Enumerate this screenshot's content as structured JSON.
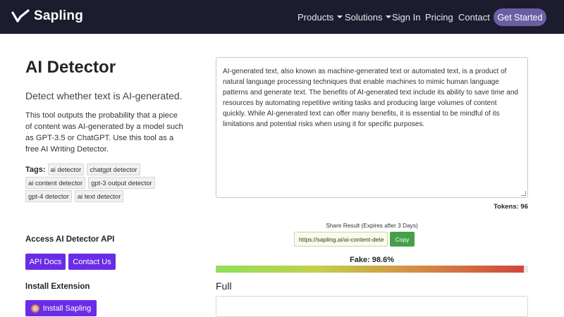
{
  "navbar": {
    "brand": "Sapling",
    "items": [
      {
        "label": "Products",
        "dropdown": true
      },
      {
        "label": "Solutions",
        "dropdown": true
      },
      {
        "label": "Sign In",
        "dropdown": false
      },
      {
        "label": "Pricing",
        "dropdown": false
      },
      {
        "label": "Contact",
        "dropdown": false
      }
    ],
    "cta": "Get Started"
  },
  "left": {
    "title": "AI Detector",
    "lead": "Detect whether text is AI-generated.",
    "description": "This tool outputs the probability that a piece of content was AI-generated by a model such as GPT-3.5 or ChatGPT. Use this tool as a free AI Writing Detector.",
    "tags_label": "Tags",
    "tags": [
      "ai detector",
      "chatgpt detector",
      "ai content detector",
      "gpt-3 output detector",
      "gpt-4 detector",
      "ai text detector"
    ],
    "api_heading": "Access AI Detector API",
    "api_docs_label": "API Docs",
    "contact_us_label": "Contact Us",
    "extension_heading": "Install Extension",
    "install_label": "Install Sapling"
  },
  "right": {
    "input_text": "AI-generated text, also known as machine-generated text or automated text, is a product of natural language processing techniques that enable machines to mimic human language patterns and generate text. The benefits of AI-generated text include its ability to save time and resources by automating repetitive writing tasks and producing large volumes of content quickly. While AI-generated text can offer many benefits, it is essential to be mindful of its limitations and potential risks when using it for specific purposes.",
    "tokens_label": "Tokens: 96",
    "share_label": "Share Result (Expires after 3 Days)",
    "share_url": "https://sapling.ai/ai-content-dete",
    "copy_label": "Copy",
    "fake_label": "Fake: 98.6%",
    "fake_fraction": 0.986,
    "full_heading": "Full"
  },
  "colors": {
    "navbar_bg": "#1c1c2e",
    "cta_bg": "#6b5fa3",
    "button_purple": "#6a2ce6",
    "copy_green": "#45a049"
  }
}
